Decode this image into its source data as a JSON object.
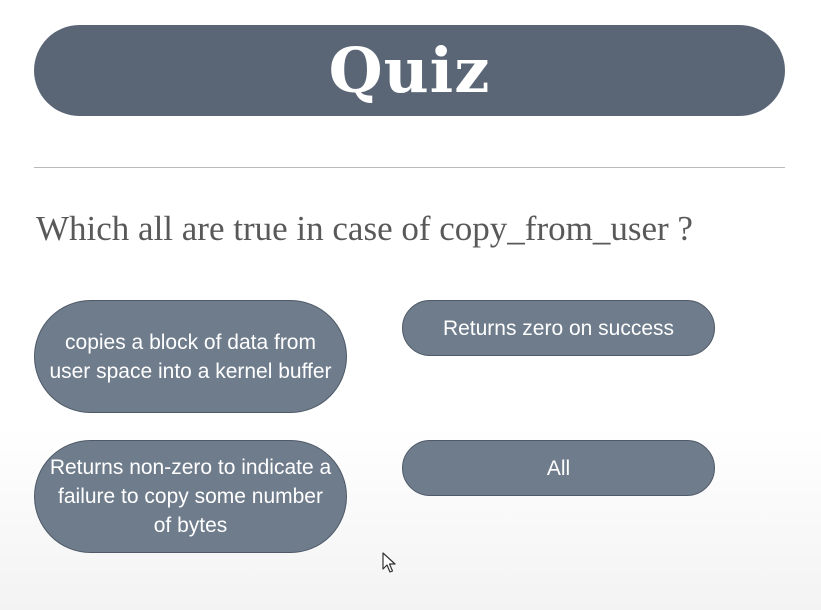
{
  "slide": {
    "title": "Quiz",
    "question": "Which all are true in case of copy_from_user ?"
  },
  "options": [
    {
      "label": "copies a block of data from user space into a kernel buffer"
    },
    {
      "label": "Returns zero on success"
    },
    {
      "label": "Returns non-zero to indicate a failure to copy some number of bytes"
    },
    {
      "label": "All"
    }
  ],
  "colors": {
    "banner": "#5a6676",
    "option_fill": "#6f7c8c",
    "option_border": "#4f5a68",
    "question_text": "#595959"
  },
  "icons": {
    "cursor": "mouse-pointer-icon"
  }
}
